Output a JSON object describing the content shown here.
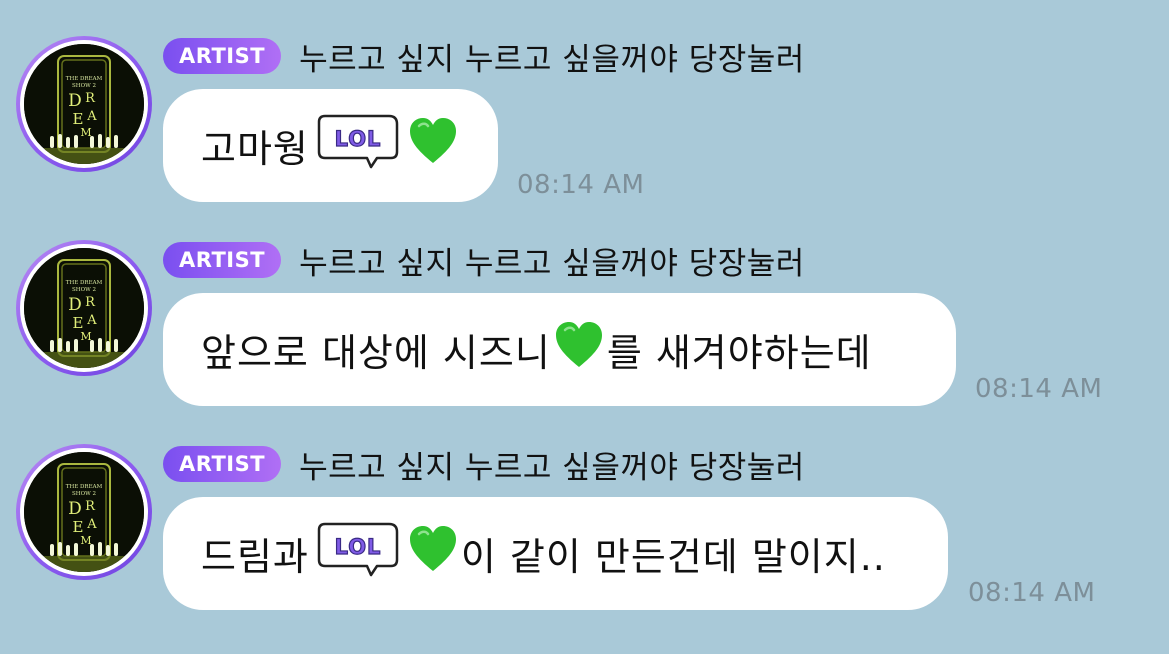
{
  "chat": {
    "colors": {
      "background": "#a9c9d8",
      "badge": "#8d5cf0",
      "bubble": "#ffffff",
      "heart": "#2fc12f",
      "timestamp": "#7d8f99"
    },
    "messages": [
      {
        "badge": "ARTIST",
        "sender": "누르고 싶지 누르고 싶을꺼야 당장눌러",
        "text_1": "고마웡",
        "sticker_1": "LOL",
        "text_2": "",
        "time": "08:14 AM"
      },
      {
        "badge": "ARTIST",
        "sender": "누르고 싶지 누르고 싶을꺼야 당장눌러",
        "text_1": "앞으로 대상에 시즈니",
        "text_2": "를 새겨야하는데",
        "time": "08:14 AM"
      },
      {
        "badge": "ARTIST",
        "sender": "누르고 싶지 누르고 싶을꺼야 당장눌러",
        "text_1": "드림과",
        "sticker_1": "LOL",
        "text_2": "이 같이 만든건데 말이지..",
        "time": "08:14 AM"
      }
    ],
    "avatar_image_text": "THE DREAM SHOW 2"
  }
}
